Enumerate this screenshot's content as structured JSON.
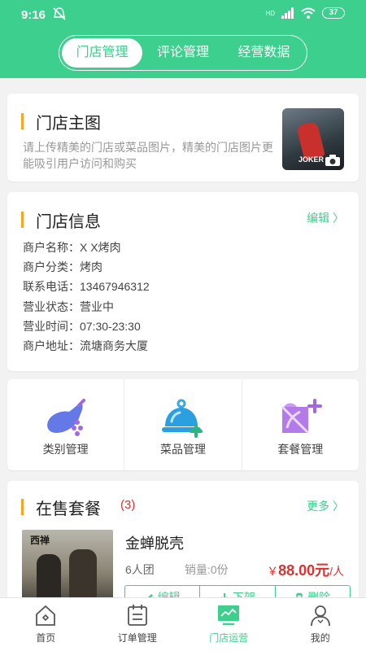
{
  "status_bar": {
    "time": "9:16",
    "battery": "37",
    "net": "HD"
  },
  "tabs": [
    {
      "label": "门店管理",
      "active": true
    },
    {
      "label": "评论管理",
      "active": false
    },
    {
      "label": "经营数据",
      "active": false
    }
  ],
  "store_photo": {
    "title": "门店主图",
    "description": "请上传精美的门店或菜品图片，精美的门店图片更能吸引用户访问和购买",
    "thumb_caption": "JOKER"
  },
  "store_info": {
    "title": "门店信息",
    "edit_label": "编辑 〉",
    "rows": [
      "商户名称：X X烤肉",
      "商户分类：烤肉",
      "联系电话：13467946312",
      "营业状态：营业中",
      "营业时间：07:30-23:30",
      "商户地址：流塘商务大厦"
    ]
  },
  "management": [
    {
      "label": "类别管理",
      "icon": "category-icon"
    },
    {
      "label": "菜品管理",
      "icon": "dish-icon"
    },
    {
      "label": "套餐管理",
      "icon": "package-icon"
    }
  ],
  "on_sale": {
    "title": "在售套餐",
    "count": "(3)",
    "more_label": "更多 〉",
    "package": {
      "name": "金蝉脱壳",
      "size": "6人团",
      "sold": "销量:0份",
      "price_symbol": "￥",
      "price": "88.00元",
      "unit": "/人",
      "image_caption": "西禅",
      "actions": [
        "编辑",
        "下架",
        "删除"
      ]
    }
  },
  "bottom_nav": [
    {
      "label": "首页",
      "icon": "home-icon",
      "active": false
    },
    {
      "label": "订单管理",
      "icon": "order-icon",
      "active": false
    },
    {
      "label": "门店运营",
      "icon": "store-ops-icon",
      "active": true
    },
    {
      "label": "我的",
      "icon": "profile-icon",
      "active": false
    }
  ],
  "colors": {
    "primary": "#3ccf8e",
    "accent": "#f5a623",
    "price": "#e0302e"
  }
}
